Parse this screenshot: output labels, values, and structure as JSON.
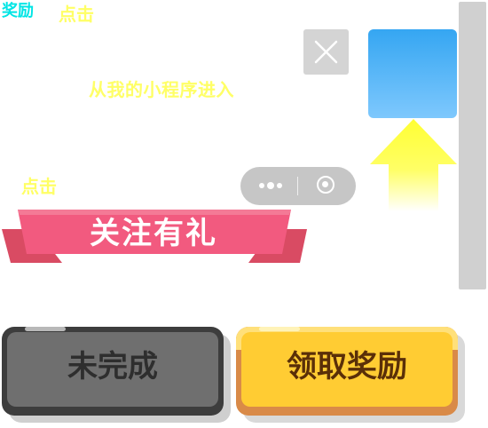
{
  "labels": {
    "reward_tag": "奖励",
    "click_top": "点击",
    "hint": "从我的小程序进入",
    "click_mid": "点击"
  },
  "ribbon": {
    "title": "关注有礼"
  },
  "buttons": {
    "incomplete": "未完成",
    "claim": "领取奖励"
  },
  "icons": {
    "close": "close-icon",
    "more": "more-dots-icon",
    "target": "target-icon",
    "arrow": "arrow-up-icon"
  },
  "colors": {
    "cyan_text": "#00e5e5",
    "yellow_text": "#ffff66",
    "ribbon_pink": "#f25a7f",
    "claim_yellow": "#ffcc33",
    "incomplete_gray": "#6f6f6f"
  }
}
